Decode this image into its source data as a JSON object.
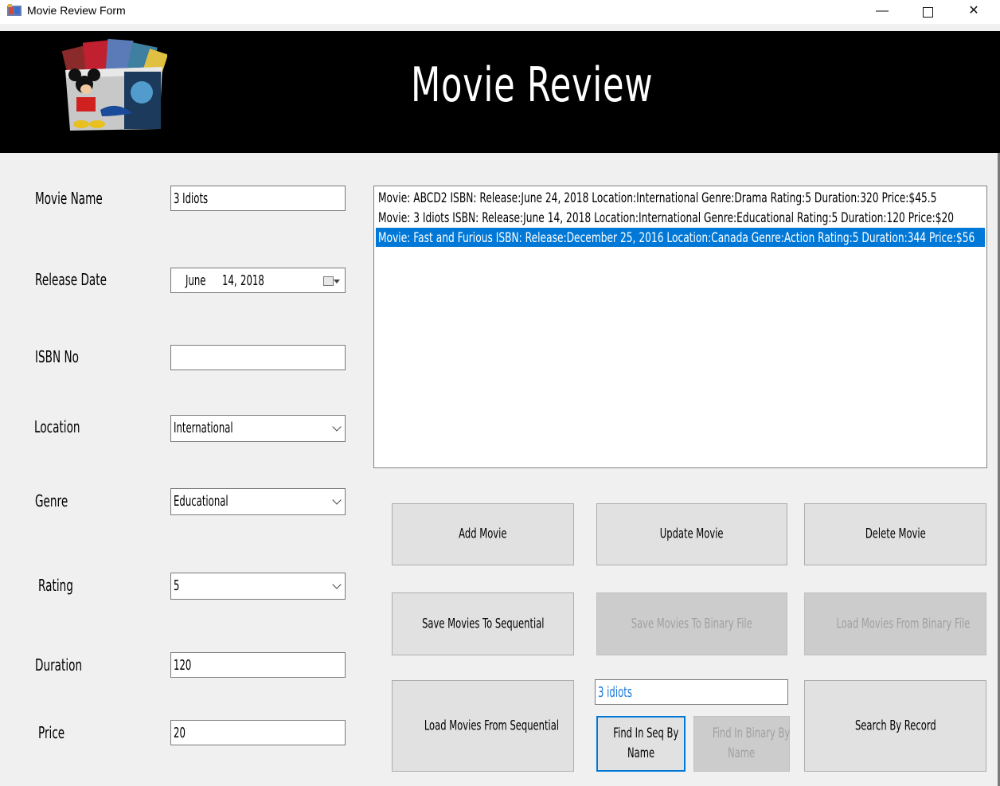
{
  "window": {
    "title": "Movie Review Form",
    "minimize": "—",
    "close": "✕"
  },
  "banner": {
    "title": "Movie Review"
  },
  "form": {
    "movie_name": {
      "label": "Movie Name",
      "value": "3 Idiots"
    },
    "release_date": {
      "label": "Release Date",
      "month": "June",
      "day": "14,",
      "year": "2018"
    },
    "isbn": {
      "label": "ISBN No",
      "value": ""
    },
    "location": {
      "label": "Location",
      "value": "International"
    },
    "genre": {
      "label": "Genre",
      "value": "Educational"
    },
    "rating": {
      "label": "Rating",
      "value": "5"
    },
    "duration": {
      "label": "Duration",
      "value": "120"
    },
    "price": {
      "label": "Price",
      "value": "20"
    }
  },
  "movie_list": {
    "items": [
      "Movie: ABCD2 ISBN:   Release:June 24, 2018  Location:International  Genre:Drama  Rating:5  Duration:320  Price:$45.5",
      "Movie: 3 Idiots ISBN:   Release:June 14, 2018  Location:International  Genre:Educational  Rating:5  Duration:120  Price:$20",
      "Movie: Fast and Furious ISBN:   Release:December 25, 2016  Location:Canada  Genre:Action  Rating:5  Duration:344  Price:$56"
    ],
    "selected_index": 2
  },
  "buttons": {
    "add": "Add Movie",
    "update": "Update Movie",
    "delete": "Delete Movie",
    "save_seq": "Save Movies To Sequential",
    "save_bin": "Save Movies To Binary File",
    "load_bin": "Load Movies From Binary File",
    "load_seq": "Load Movies From Sequential",
    "find_seq_1": "Find In Seq By",
    "find_seq_2": "Name",
    "find_bin_1": "Find In Binary By",
    "find_bin_2": "Name",
    "search_record": "Search By Record"
  },
  "search": {
    "value": "3 idiots"
  },
  "colors": {
    "selection": "#0078d7",
    "banner_bg": "#000000",
    "window_bg": "#f0f0f0"
  }
}
